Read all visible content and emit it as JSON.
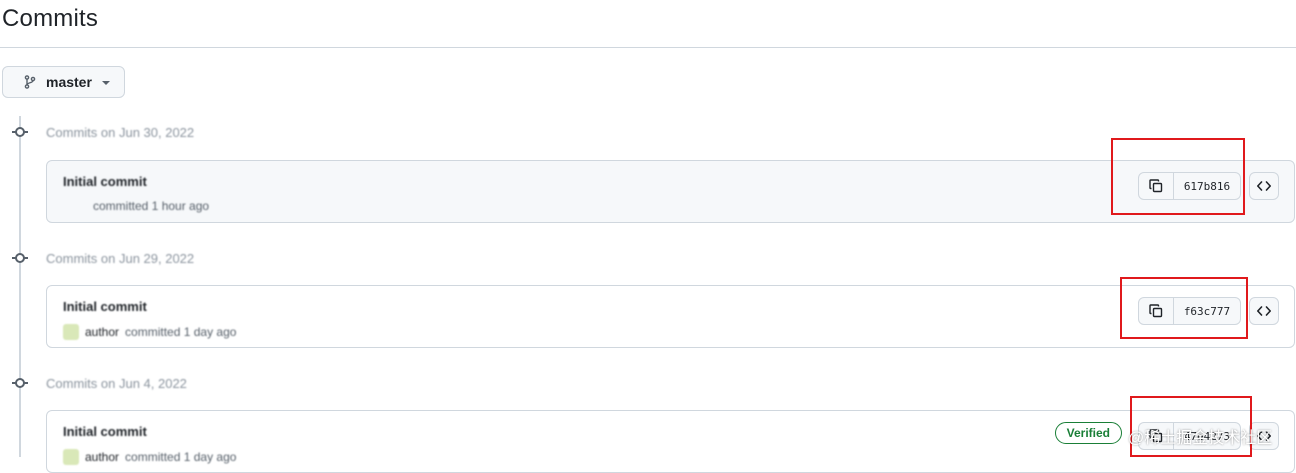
{
  "page": {
    "title": "Commits"
  },
  "branch_selector": {
    "label": "master",
    "icon": "git-branch-icon"
  },
  "groups": [
    {
      "date": "Commits on Jun 30, 2022",
      "commit": {
        "message": "Initial commit",
        "author": "",
        "meta": "committed 1 hour ago",
        "sha": "617b816",
        "verified": false
      }
    },
    {
      "date": "Commits on Jun 29, 2022",
      "commit": {
        "message": "Initial commit",
        "author": "author",
        "meta": "committed 1 day ago",
        "sha": "f63c777",
        "verified": false
      }
    },
    {
      "date": "Commits on Jun 4, 2022",
      "commit": {
        "message": "Initial commit",
        "author": "author",
        "meta": "committed 1 day ago",
        "sha": "47e4273",
        "verified": true,
        "verified_label": "Verified"
      }
    }
  ],
  "watermark": "@稀土掘金技术社区",
  "colors": {
    "annotation_red": "#e0191c",
    "verified_green": "#1a7f37",
    "border": "#d0d7de"
  }
}
